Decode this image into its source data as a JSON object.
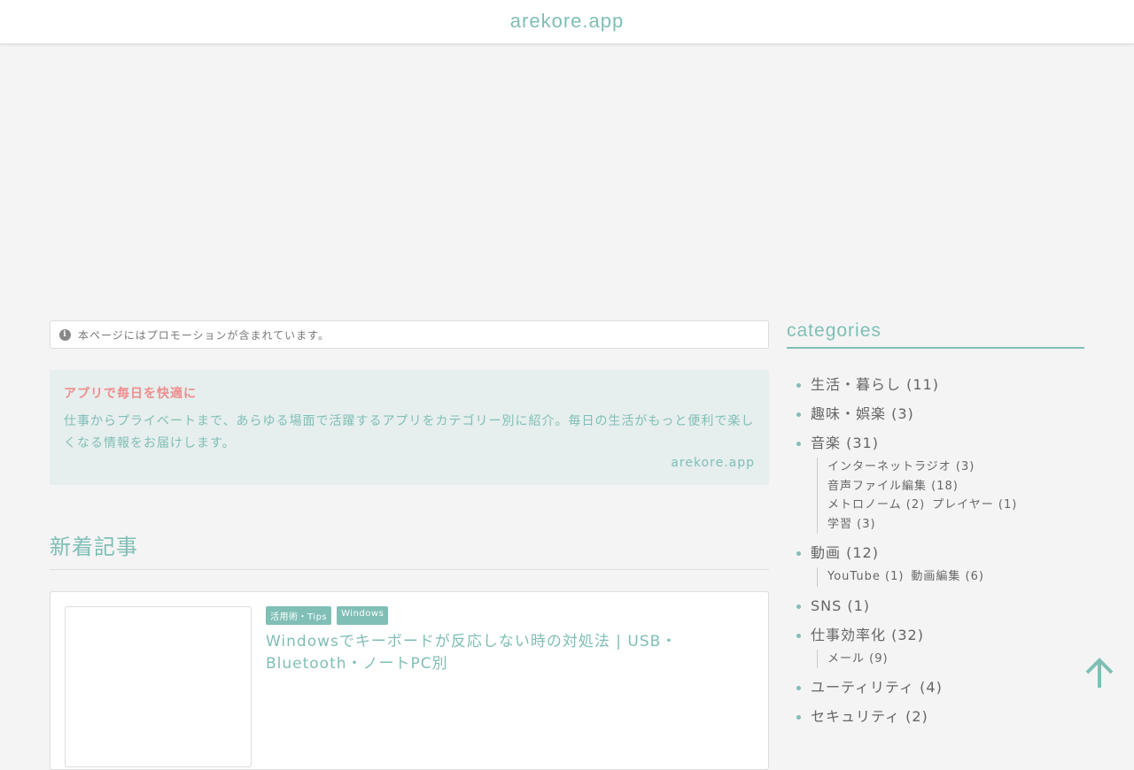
{
  "header": {
    "site_title": "arekore.app"
  },
  "promo": {
    "text": "本ページにはプロモーションが含まれています。"
  },
  "intro": {
    "heading": "アプリで毎日を快適に",
    "text": "仕事からプライベートまで、あらゆる場面で活躍するアプリをカテゴリー別に紹介。毎日の生活がもっと便利で楽しくなる情報をお届けします。",
    "signature": "arekore.app"
  },
  "main": {
    "section_title": "新着記事",
    "articles": [
      {
        "tags": [
          "活用術・Tips",
          "Windows"
        ],
        "title": "Windowsでキーボードが反応しない時の対処法 | USB・Bluetooth・ノートPC別"
      }
    ]
  },
  "sidebar": {
    "title": "categories",
    "categories": [
      {
        "label": "生活・暮らし (11)"
      },
      {
        "label": "趣味・娯楽 (3)"
      },
      {
        "label": "音楽 (31)",
        "sub": [
          "インターネットラジオ (3)",
          "音声ファイル編集 (18)",
          "メトロノーム (2)",
          "プレイヤー (1)",
          "学習 (3)"
        ]
      },
      {
        "label": "動画 (12)",
        "sub": [
          "YouTube (1)",
          "動画編集 (6)"
        ]
      },
      {
        "label": "SNS (1)"
      },
      {
        "label": "仕事効率化 (32)",
        "sub": [
          "メール (9)"
        ]
      },
      {
        "label": "ユーティリティ (4)"
      },
      {
        "label": "セキュリティ (2)"
      }
    ]
  },
  "icons": {
    "info": "info-icon",
    "back_to_top": "arrow-up-icon"
  },
  "colors": {
    "accent": "#7fbfb6",
    "heading_red": "#f08c8c",
    "background": "#f4f4f4"
  }
}
